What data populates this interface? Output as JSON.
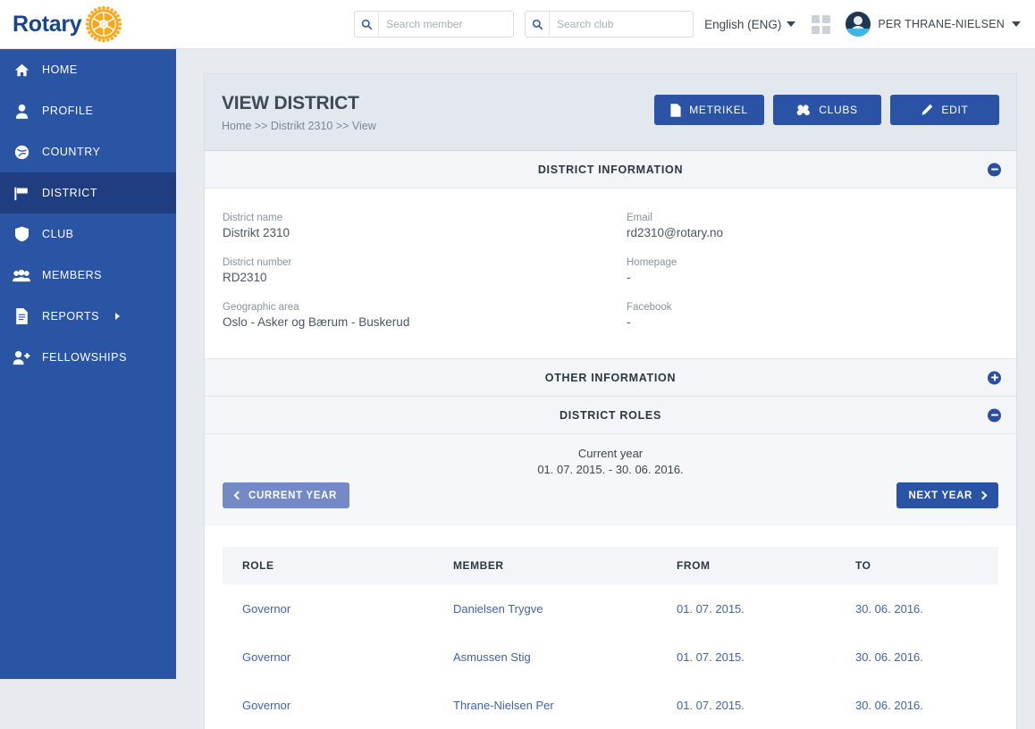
{
  "brand": {
    "name": "Rotary",
    "logo_icon": "rotary-gear-icon",
    "navy": "#17458f",
    "gold": "#f7a81b"
  },
  "topbar": {
    "search_member": {
      "placeholder": "Search member",
      "value": "",
      "icon": "search-icon"
    },
    "search_club": {
      "placeholder": "Search club",
      "value": "",
      "icon": "search-icon"
    },
    "language": {
      "label": "English (ENG)",
      "caret_icon": "chevron-down-icon"
    },
    "apps_icon": "grid-apps-icon",
    "user": {
      "name": "PER THRANE-NIELSEN",
      "avatar_icon": "user-avatar-icon",
      "caret_icon": "chevron-down-icon"
    }
  },
  "sidebar": {
    "accent": "#2a54a4",
    "active_color": "#1f3d7f",
    "items": [
      {
        "label": "HOME",
        "icon": "home-icon",
        "active": false,
        "has_submenu": false
      },
      {
        "label": "PROFILE",
        "icon": "user-icon",
        "active": false,
        "has_submenu": false
      },
      {
        "label": "COUNTRY",
        "icon": "globe-icon",
        "active": false,
        "has_submenu": false
      },
      {
        "label": "DISTRICT",
        "icon": "flag-icon",
        "active": true,
        "has_submenu": false
      },
      {
        "label": "CLUB",
        "icon": "shield-icon",
        "active": false,
        "has_submenu": false
      },
      {
        "label": "MEMBERS",
        "icon": "users-icon",
        "active": false,
        "has_submenu": false
      },
      {
        "label": "REPORTS",
        "icon": "document-icon",
        "active": false,
        "has_submenu": true
      },
      {
        "label": "FELLOWSHIPS",
        "icon": "user-plus-icon",
        "active": false,
        "has_submenu": false
      }
    ]
  },
  "page": {
    "title": "VIEW DISTRICT",
    "breadcrumb": "Home >> Distrikt 2310 >> View",
    "actions": [
      {
        "label": "METRIKEL",
        "icon": "file-icon"
      },
      {
        "label": "CLUBS",
        "icon": "cubes-icon"
      },
      {
        "label": "EDIT",
        "icon": "pencil-icon"
      }
    ]
  },
  "sections": {
    "district_information": {
      "title": "DISTRICT INFORMATION",
      "expanded": true,
      "toggle_icon": "minus-circle-icon"
    },
    "other_information": {
      "title": "OTHER INFORMATION",
      "expanded": false,
      "toggle_icon": "plus-circle-icon"
    },
    "district_roles": {
      "title": "DISTRICT ROLES",
      "expanded": true,
      "toggle_icon": "minus-circle-icon"
    }
  },
  "district_info": {
    "left": [
      {
        "label": "District name",
        "value": "Distrikt 2310"
      },
      {
        "label": "District number",
        "value": "RD2310"
      },
      {
        "label": "Geographic area",
        "value": "Oslo - Asker og Bærum - Buskerud"
      }
    ],
    "right": [
      {
        "label": "Email",
        "value": "rd2310@rotary.no"
      },
      {
        "label": "Homepage",
        "value": "-"
      },
      {
        "label": "Facebook",
        "value": "-"
      }
    ]
  },
  "year_nav": {
    "current_label": "Current year",
    "current_range": "01. 07. 2015. - 30. 06. 2016.",
    "prev_button": {
      "label": "CURRENT YEAR",
      "icon": "chevron-left-icon"
    },
    "next_button": {
      "label": "NEXT YEAR",
      "icon": "chevron-right-icon"
    }
  },
  "roles_table": {
    "columns": [
      "ROLE",
      "MEMBER",
      "FROM",
      "TO"
    ],
    "rows": [
      {
        "role": "Governor",
        "member": "Danielsen Trygve",
        "from": "01. 07. 2015.",
        "to": "30. 06. 2016."
      },
      {
        "role": "Governor",
        "member": "Asmussen Stig",
        "from": "01. 07. 2015.",
        "to": "30. 06. 2016."
      },
      {
        "role": "Governor",
        "member": "Thrane-Nielsen Per",
        "from": "01. 07. 2015.",
        "to": "30. 06. 2016."
      }
    ]
  }
}
